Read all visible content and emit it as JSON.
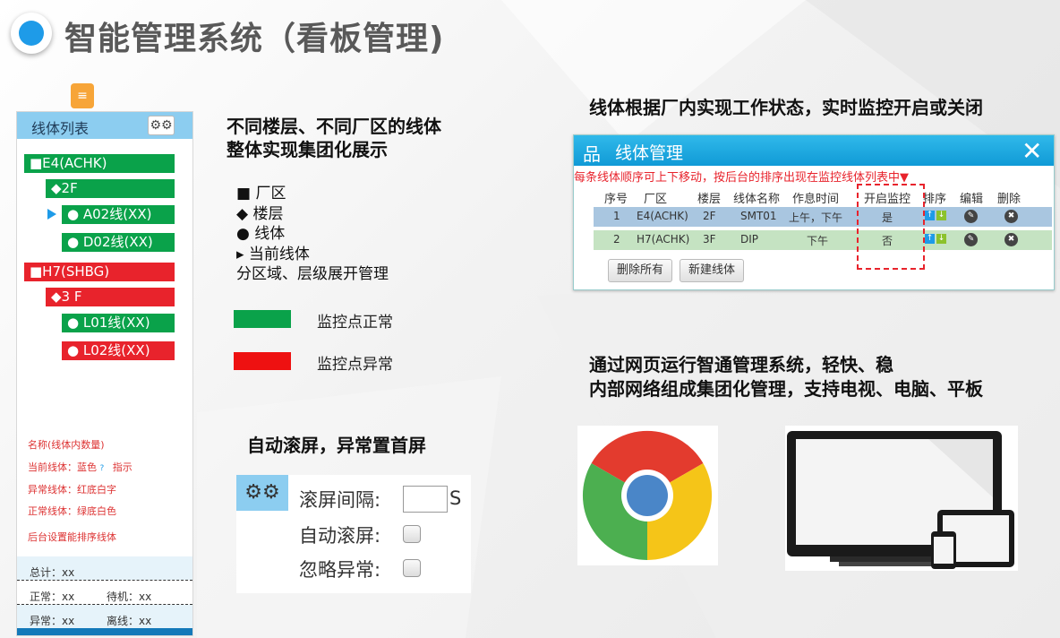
{
  "page": {
    "title": "智能管理系统（看板管理)"
  },
  "sidebar": {
    "header": "线体列表",
    "gear_icon": "gear-icon",
    "nodes": [
      {
        "label": "■E4(ACHK)",
        "status": "normal"
      },
      {
        "label": "◆2F",
        "status": "normal"
      },
      {
        "label": "● A02线(XX)",
        "status": "normal",
        "current": true
      },
      {
        "label": "● D02线(XX)",
        "status": "normal"
      },
      {
        "label": "■H7(SHBG)",
        "status": "abnormal"
      },
      {
        "label": "◆3 F",
        "status": "abnormal"
      },
      {
        "label": "● L01线(XX)",
        "status": "normal"
      },
      {
        "label": "● L02线(XX)",
        "status": "abnormal"
      }
    ],
    "legend": {
      "name_note": "名称(线体内数量)",
      "current_prefix": "当前线体：蓝色",
      "current_q": "?",
      "current_suffix": "指示",
      "abnormal_note": "异常线体：红底白字",
      "normal_note": "正常线体：绿底白色",
      "sort_note": "后台设置能排序线体"
    },
    "stats": {
      "total": "总计：xx",
      "normal": "正常：xx",
      "standby": "待机：xx",
      "abnormal": "异常：xx",
      "offline": "离线：xx"
    }
  },
  "middle": {
    "heading_line1": "不同楼层、不同厂区的线体",
    "heading_line2": "整体实现集团化展示",
    "bullets": [
      "■ 厂区",
      "◆ 楼层",
      "● 线体",
      "▸ 当前线体",
      "分区域、层级展开管理"
    ],
    "legend_normal": "监控点正常",
    "legend_abnormal": "监控点异常",
    "scroll_heading": "自动滚屏，异常置首屏"
  },
  "scroll_settings": {
    "interval_label": "滚屏间隔:",
    "interval_value": "",
    "interval_unit": "S",
    "auto_scroll_label": "自动滚屏:",
    "ignore_abnormal_label": "忽略异常:"
  },
  "right": {
    "top_heading": "线体根据厂内实现工作状态，实时监控开启或关闭",
    "bottom_heading_line1": "通过网页运行智通管理系统，轻快、稳",
    "bottom_heading_line2": "内部网络组成集团化管理，支持电视、电脑、平板"
  },
  "dialog": {
    "title": "线体管理",
    "close": "✕",
    "note": "每条线体顺序可上下移动，按后台的排序出现在监控线体列表中▼",
    "columns": [
      "序号",
      "厂区",
      "楼层",
      "线体名称",
      "作息时间",
      "开启监控",
      "排序",
      "编辑",
      "删除"
    ],
    "rows": [
      {
        "no": "1",
        "factory": "E4(ACHK)",
        "floor": "2F",
        "line": "SMT01",
        "schedule": "上午，下午",
        "monitor": "是"
      },
      {
        "no": "2",
        "factory": "H7(ACHK)",
        "floor": "3F",
        "line": "DIP",
        "schedule": "下午",
        "monitor": "否"
      }
    ],
    "delete_all": "删除所有",
    "new_line": "新建线体"
  },
  "colors": {
    "normal": "#0aa24a",
    "abnormal": "#e8232c",
    "accent": "#1e9be8"
  }
}
